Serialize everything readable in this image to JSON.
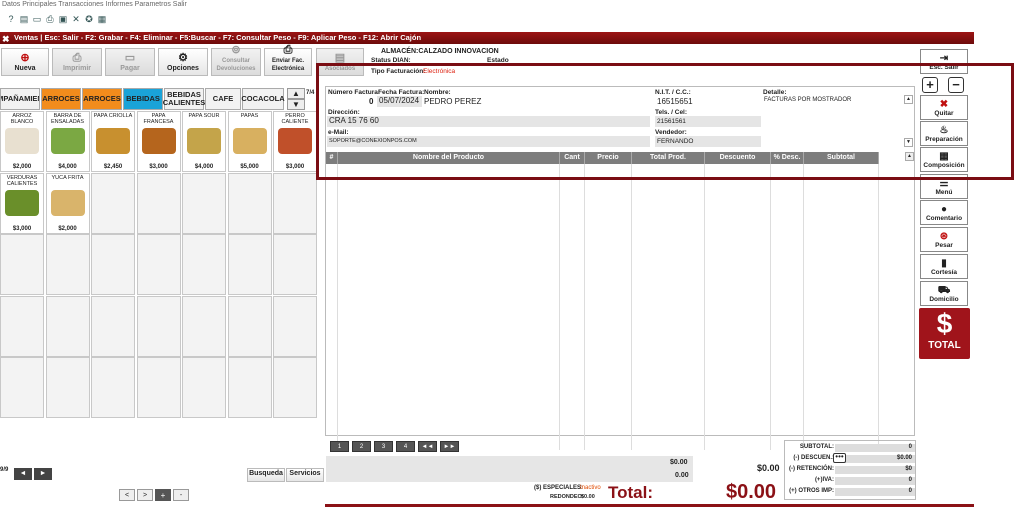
{
  "menubar": {
    "text": "Datos  Principales  Transacciones  Informes  Parametros  Salir"
  },
  "titlebar": {
    "text": "Ventas  |  Esc: Salir  - F2: Grabar  - F4: Eliminar  - F5:Buscar  - F7: Consultar Peso  - F9: Aplicar Peso  - F12: Abrir Cajón"
  },
  "toolbar": {
    "nueva": "Nueva",
    "imprimir": "Imprimir",
    "pagar": "Pagar",
    "opciones": "Opciones",
    "consultar": "Consultar Devoluciones",
    "enviar": "Enviar Fac. Electrónica",
    "asociados": "Asociados"
  },
  "header": {
    "almacen": "ALMACÉN:CALZADO INNOVACION",
    "status_label": "Status DIAN:",
    "estado_label": "Estado",
    "tipo_label": "Tipo Facturación:",
    "tipo_value": "Electrónica"
  },
  "categories": {
    "items": [
      "MPAÑAMIEN",
      "ARROCES",
      "ARROCES",
      "BEBIDAS",
      "BEBIDAS CALIENTES",
      "CAFE",
      "COCACOLA"
    ],
    "page": "7/4"
  },
  "products": [
    {
      "name": "ARROZ BLANCO",
      "price": "$2,000"
    },
    {
      "name": "BARRA DE ENSALADAS",
      "price": "$4,000"
    },
    {
      "name": "PAPA CRIOLLA",
      "price": "$2,450"
    },
    {
      "name": "PAPA FRANCESA",
      "price": "$3,000"
    },
    {
      "name": "PAPA SOUR",
      "price": "$4,000"
    },
    {
      "name": "PAPAS",
      "price": "$5,000"
    },
    {
      "name": "PERRO CALIENTE",
      "price": "$3,000"
    },
    {
      "name": "VERDURAS CALIENTES",
      "price": "$3,000"
    },
    {
      "name": "YUCA FRITA",
      "price": "$2,000"
    }
  ],
  "left_footer": {
    "pager": "9/9",
    "busqueda": "Busqueda",
    "servicios": "Servicios",
    "nav": [
      "<",
      ">",
      "+",
      "-"
    ]
  },
  "invoice": {
    "numero_label": "Número Factura:",
    "numero_value": "0",
    "fecha_label": "Fecha Factura:",
    "fecha_value": "05/07/2024",
    "nombre_label": "Nombre:",
    "nombre_value": "PEDRO PEREZ",
    "nit_label": "N.I.T. / C.C.:",
    "nit_value": "16515651",
    "detalle_label": "Detalle:",
    "detalle_value": "FACTURAS POR MOSTRADOR",
    "direccion_label": "Dirección:",
    "direccion_value": "CRA 15 76 60",
    "tels_label": "Tels. / Cel:",
    "tels_value": "21561561",
    "email_label": "e-Mail:",
    "email_value": "SOPORTE@CONEXIONPOS.COM",
    "vendedor_label": "Vendedor:",
    "vendedor_value": "FERNANDO"
  },
  "table": {
    "headers": [
      "#",
      "Nombre del Producto",
      "Cant",
      "Precio",
      "Total Prod.",
      "Descuento",
      "% Desc.",
      "Subtotal"
    ]
  },
  "pagination": [
    "1",
    "2",
    "3",
    "4",
    "◄◄",
    "►►"
  ],
  "totals": {
    "mid1": "$0.00",
    "mid2": "0.00",
    "mid3": "$0.00",
    "especiales_label": "($) ESPECIALES:",
    "especiales_value": "Inactivo",
    "redondeo_label": "REDONDEO:",
    "redondeo_value": "$0.00",
    "total_label": "Total:",
    "total_value": "$0.00"
  },
  "summary": [
    {
      "label": "SUBTOTAL:",
      "value": "0"
    },
    {
      "label": "(-) DESCUEN.:",
      "value": "$0.00"
    },
    {
      "label": "(-) RETENCIÓN:",
      "value": "$0"
    },
    {
      "label": "(+)IVA:",
      "value": "0"
    },
    {
      "label": "(+) OTROS IMP:",
      "value": "0"
    }
  ],
  "right_buttons": {
    "esc": "Esc. Salir",
    "quitar": "Quitar",
    "preparacion": "Preparación",
    "composicion": "Composición",
    "menu": "Menú",
    "comentario": "Comentario",
    "pesar": "Pesar",
    "cortesia": "Cortesía",
    "domicilio": "Domicilio",
    "total": "TOTAL"
  },
  "colors": {
    "accent_red": "#8b1116",
    "orange": "#f28c1c",
    "blue": "#1aa3d8"
  }
}
